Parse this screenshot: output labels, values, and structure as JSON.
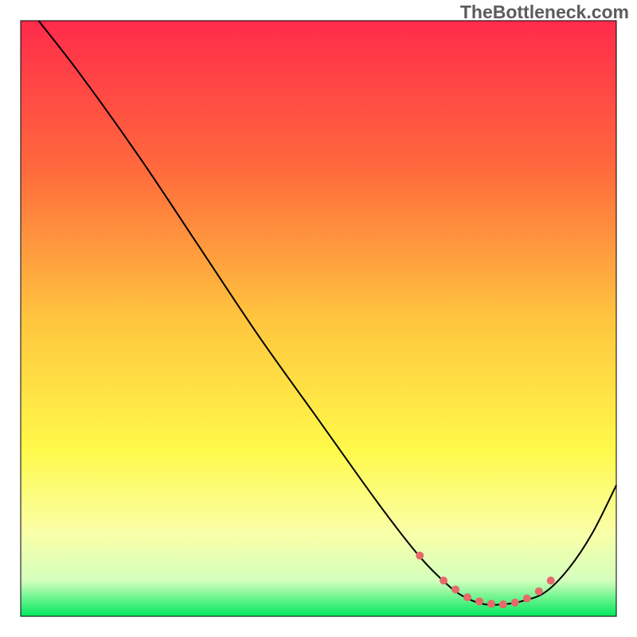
{
  "watermark": "TheBottleneck.com",
  "chart_data": {
    "type": "line",
    "title": "",
    "xlabel": "",
    "ylabel": "",
    "xlim": [
      0,
      100
    ],
    "ylim": [
      0,
      100
    ],
    "background_gradient": {
      "stops": [
        {
          "offset": 0,
          "color": "#ff2b4b"
        },
        {
          "offset": 25,
          "color": "#ff6a3d"
        },
        {
          "offset": 50,
          "color": "#ffc53e"
        },
        {
          "offset": 72,
          "color": "#fff94a"
        },
        {
          "offset": 86,
          "color": "#f9ffa8"
        },
        {
          "offset": 94,
          "color": "#d4ffbd"
        },
        {
          "offset": 100,
          "color": "#00e85e"
        }
      ]
    },
    "series": [
      {
        "name": "bottleneck-curve",
        "color": "#000000",
        "width": 2,
        "x": [
          3,
          10,
          20,
          30,
          40,
          50,
          60,
          67,
          72,
          75,
          78,
          81,
          84,
          88,
          92,
          96,
          100
        ],
        "values": [
          100,
          91,
          77,
          62,
          47,
          33,
          19,
          10,
          5,
          3,
          2,
          2,
          2.5,
          4,
          8,
          14,
          22
        ]
      },
      {
        "name": "optimal-range-markers",
        "color": "#e76a6a",
        "type": "scatter",
        "marker_radius": 5,
        "x": [
          67,
          71,
          73,
          75,
          77,
          79,
          81,
          83,
          85,
          87,
          89
        ],
        "values": [
          10.2,
          6,
          4.5,
          3.2,
          2.5,
          2.1,
          2,
          2.3,
          3,
          4.2,
          6
        ]
      }
    ]
  }
}
